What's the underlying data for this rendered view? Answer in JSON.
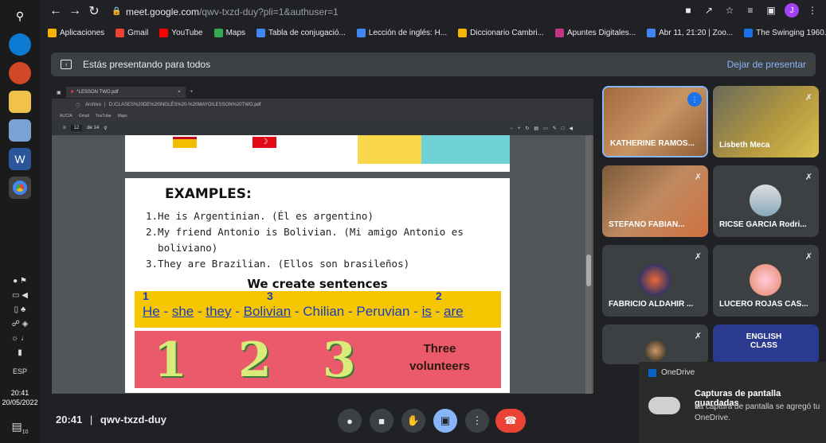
{
  "browser": {
    "url_host": "meet.google.com",
    "url_path": "/qwv-txzd-duy?pli=1&authuser=1",
    "profile_initial": "J"
  },
  "bookmarks": [
    {
      "label": "Aplicaciones",
      "color": "#f4b400"
    },
    {
      "label": "Gmail",
      "color": "#ea4335"
    },
    {
      "label": "YouTube",
      "color": "#ff0000"
    },
    {
      "label": "Maps",
      "color": "#34a853"
    },
    {
      "label": "Tabla de conjugació...",
      "color": "#4285f4"
    },
    {
      "label": "Lección de inglés: H...",
      "color": "#4285f4"
    },
    {
      "label": "Diccionario Cambri...",
      "color": "#f4b400"
    },
    {
      "label": "Apuntes Digitales...",
      "color": "#c13584"
    },
    {
      "label": "Abr 11, 21:20 | Zoo...",
      "color": "#4285f4"
    },
    {
      "label": "The Swinging 1960...",
      "color": "#1a73e8"
    }
  ],
  "meet": {
    "present_banner": "Estás presentando para todos",
    "stop_presenting": "Dejar de presentar",
    "meeting_time": "20:41",
    "meeting_code": "qwv-txzd-duy",
    "separator": "|"
  },
  "shared_screen": {
    "tab_title": "*LESSON TWO.pdf",
    "url_label": "Archivo",
    "url": "D:/CLASES%20DE%20INGLÉS%20-%20MAYO/LESSON%20TWO.pdf",
    "bookmarks": [
      "ALICIA",
      "Gmail",
      "YouTube",
      "Maps"
    ],
    "page_current": "12",
    "page_total": "de 14",
    "examples_title": "EXAMPLES:",
    "examples": [
      "1.He is Argentinian. (Él es argentino)",
      "2.My friend Antonio is Bolivian. (Mi amigo Antonio es",
      "  boliviano)",
      "3.They are Brazilian. (Ellos son brasileños)"
    ],
    "we_create": "We create sentences",
    "marks": [
      "1",
      "3",
      "2"
    ],
    "words": {
      "he": "He",
      "she": "she",
      "they": "they",
      "bolivian": "Bolivian",
      "chilian": "Chilian",
      "peruvian": "Peruvian",
      "is": "is",
      "are": "are",
      "dash": " - "
    },
    "numbers": [
      "1",
      "2",
      "3"
    ],
    "three_volunteers_1": "Three",
    "three_volunteers_2": "volunteers"
  },
  "participants": [
    {
      "name": "KATHERINE RAMOS..."
    },
    {
      "name": "Lisbeth Meca"
    },
    {
      "name": "STEFANO FABIAN..."
    },
    {
      "name": "RICSE GARCIA Rodri..."
    },
    {
      "name": "FABRICIO ALDAHIR ..."
    },
    {
      "name": "LUCERO ROJAS CAS..."
    },
    {
      "name": ""
    },
    {
      "name": "ENGLISH CLASS"
    }
  ],
  "taskbar": {
    "lang": "ESP",
    "time": "20:41",
    "date": "20/05/2022",
    "notif_count": "10"
  },
  "toast": {
    "app": "OneDrive",
    "title": "Capturas de pantalla guardadas",
    "body": "La captura de pantalla se agregó tu OneDrive."
  }
}
